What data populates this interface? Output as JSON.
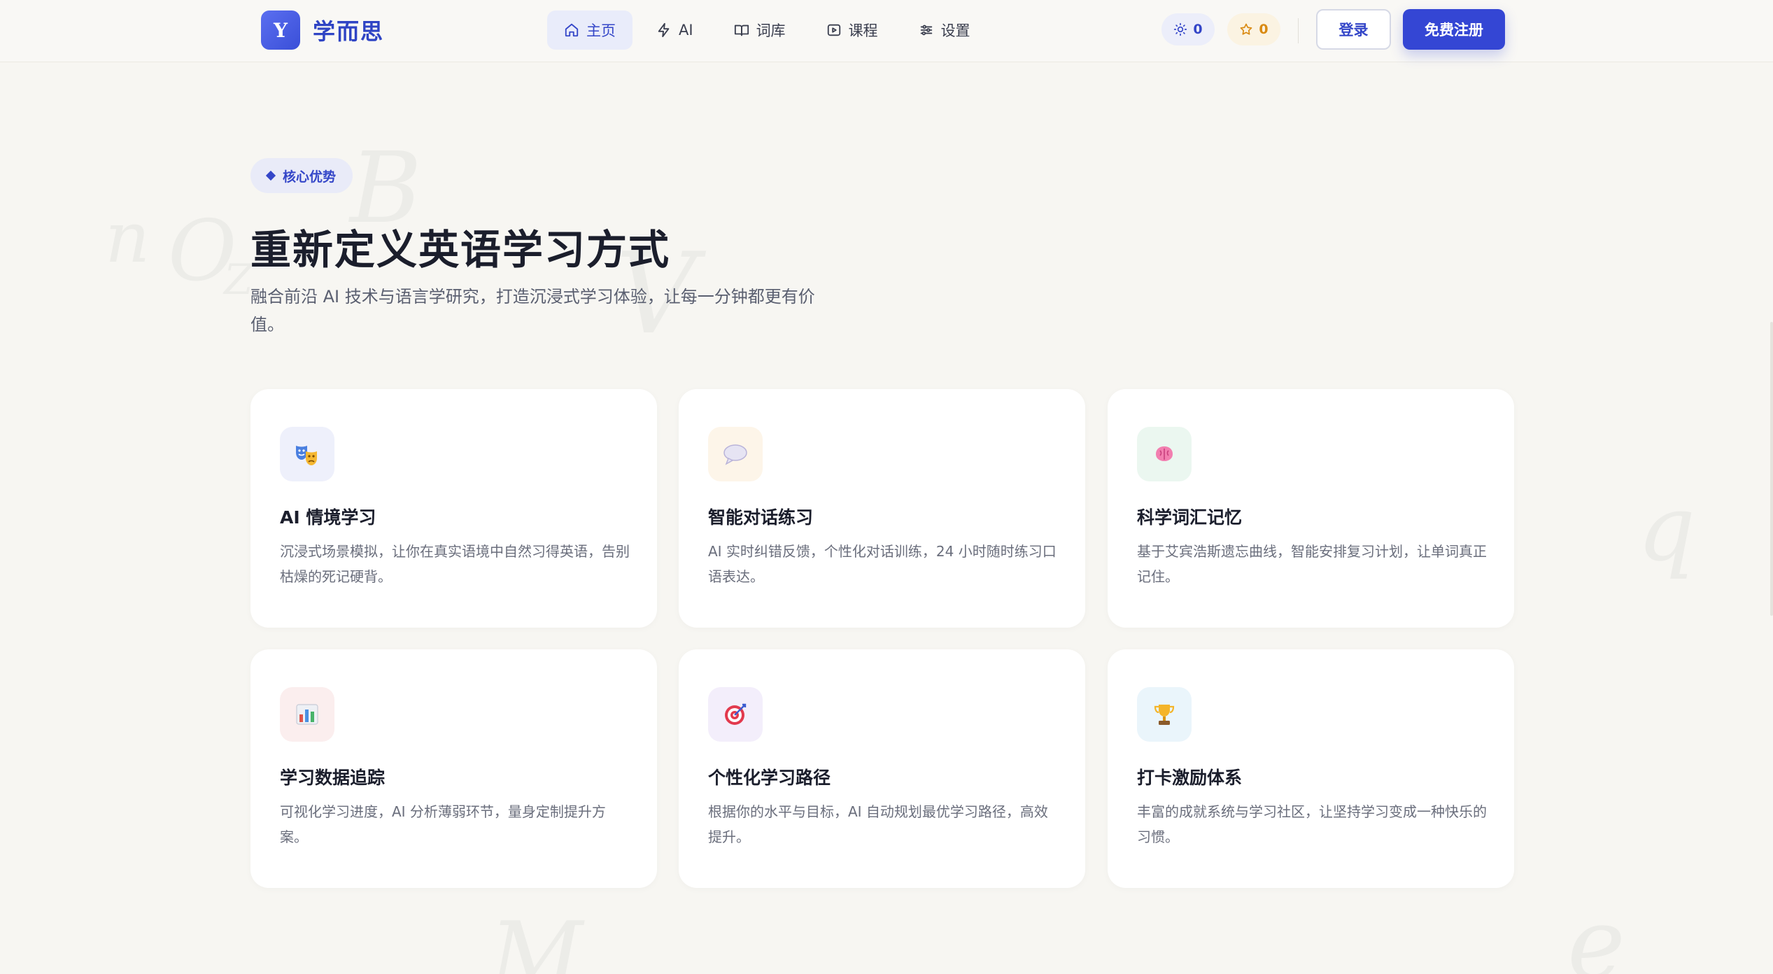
{
  "brand": {
    "logo_letter": "Y",
    "name": "学而思"
  },
  "nav": [
    {
      "label": "主页",
      "icon": "home-icon",
      "active": true
    },
    {
      "label": "AI",
      "icon": "bolt-icon",
      "active": false
    },
    {
      "label": "词库",
      "icon": "book-icon",
      "active": false
    },
    {
      "label": "课程",
      "icon": "play-icon",
      "active": false
    },
    {
      "label": "设置",
      "icon": "sliders-icon",
      "active": false
    }
  ],
  "stats": {
    "sun_count": "0",
    "star_count": "0"
  },
  "auth": {
    "login": "登录",
    "signup": "免费注册"
  },
  "hero": {
    "badge": "核心优势",
    "title": "重新定义英语学习方式",
    "subtitle": "融合前沿 AI 技术与语言学研究，打造沉浸式学习体验，让每一分钟都更有价值。"
  },
  "features": [
    {
      "title": "AI 情境学习",
      "desc": "沉浸式场景模拟，让你在真实语境中自然习得英语，告别枯燥的死记硬背。",
      "icon": "theater-masks-icon",
      "tint": "#eef0fb"
    },
    {
      "title": "智能对话练习",
      "desc": "AI 实时纠错反馈，个性化对话训练，24 小时随时练习口语表达。",
      "icon": "speech-bubble-icon",
      "tint": "#fdf5e9"
    },
    {
      "title": "科学词汇记忆",
      "desc": "基于艾宾浩斯遗忘曲线，智能安排复习计划，让单词真正记住。",
      "icon": "brain-icon",
      "tint": "#ebf7f0"
    },
    {
      "title": "学习数据追踪",
      "desc": "可视化学习进度，AI 分析薄弱环节，量身定制提升方案。",
      "icon": "bar-chart-icon",
      "tint": "#fbeeee"
    },
    {
      "title": "个性化学习路径",
      "desc": "根据你的水平与目标，AI 自动规划最优学习路径，高效提升。",
      "icon": "target-icon",
      "tint": "#f3eefb"
    },
    {
      "title": "打卡激励体系",
      "desc": "丰富的成就系统与学习社区，让坚持学习变成一种快乐的习惯。",
      "icon": "trophy-icon",
      "tint": "#eaf5fb"
    }
  ],
  "colors": {
    "accent": "#3446d4",
    "background": "#f7f6f2",
    "star": "#d98a12"
  }
}
